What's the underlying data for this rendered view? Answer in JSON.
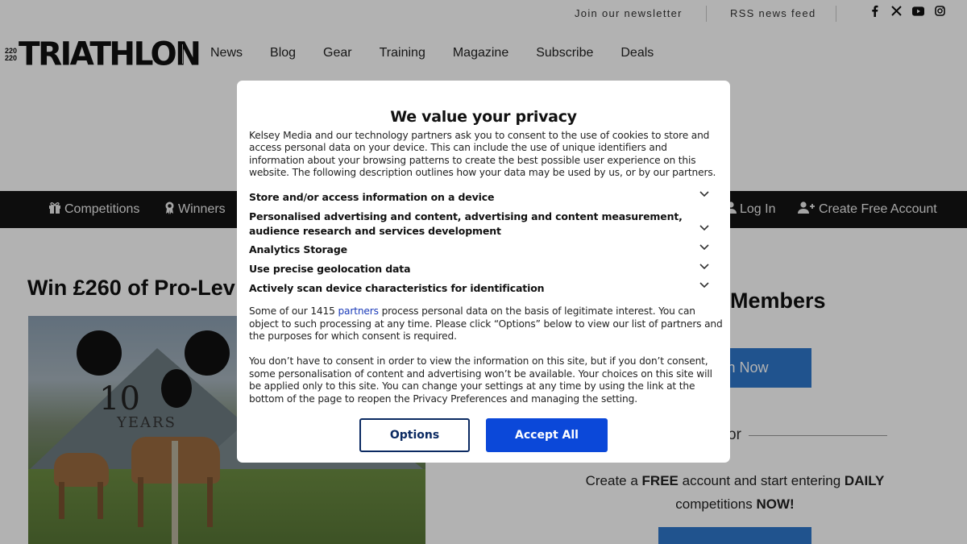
{
  "topbar": {
    "newsletter": "Join our newsletter",
    "rss": "RSS news feed",
    "social": [
      "facebook-icon",
      "x-icon",
      "youtube-icon",
      "instagram-icon"
    ]
  },
  "logo": {
    "tiny": [
      "220",
      "220"
    ],
    "word": "TRIATHLON"
  },
  "nav": [
    {
      "label": "News"
    },
    {
      "label": "Blog"
    },
    {
      "label": "Gear"
    },
    {
      "label": "Training"
    },
    {
      "label": "Magazine"
    },
    {
      "label": "Subscribe"
    },
    {
      "label": "Deals"
    }
  ],
  "blackbar": {
    "competitions": "Competitions",
    "winners": "Winners",
    "login": "Log In",
    "create": "Create Free Account"
  },
  "article": {
    "headline": "Win £260 of Pro-Lev",
    "panda_ten": "10",
    "panda_years": "YEARS"
  },
  "sidebar": {
    "members": "Members",
    "join_button": "n Now",
    "or": "or",
    "cta_a": "Create a ",
    "cta_free": "FREE",
    "cta_b": " account and start entering ",
    "cta_daily": "DAILY",
    "cta_c": "competitions ",
    "cta_now": "NOW!"
  },
  "consent": {
    "title": "We value your privacy",
    "intro": "Kelsey Media and our technology partners ask you to consent to the use of cookies to store and access personal data on your device. This can include the use of unique identifiers and information about your browsing patterns to create the best possible user experience on this website. The following description outlines how your data may be used by us, or by our partners.",
    "purposes": [
      "Store and/or access information on a device",
      "Personalised advertising and content, advertising and content measurement, audience research and services development",
      "Analytics Storage",
      "Use precise geolocation data",
      "Actively scan device characteristics for identification"
    ],
    "legit_a": "Some of our 1415 ",
    "legit_link": "partners",
    "legit_b": " process personal data on the basis of legitimate interest. You can object to such processing at any time. Please click “Options” below to view our list of partners and the purposes for which consent is required.",
    "nonconsent": "You don’t have to consent in order to view the information on this site, but if you don’t consent, some personalisation of content and advertising won’t be available. Your choices on this site will be applied only to this site. You can change your settings at any time by using the link at the bottom of the page to reopen the Privacy Preferences and managing the setting.",
    "options_label": "Options",
    "accept_label": "Accept All"
  }
}
